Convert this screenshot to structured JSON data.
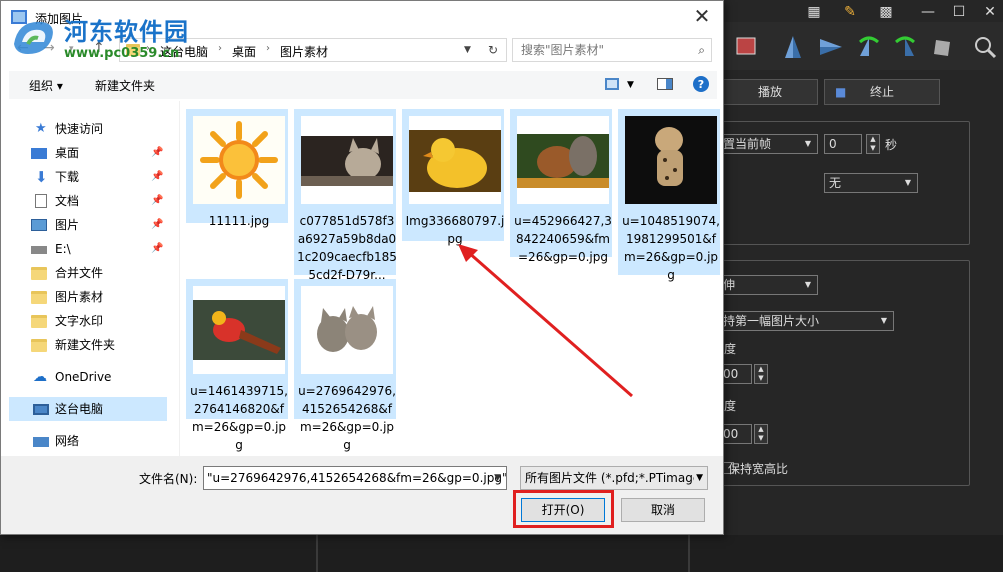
{
  "dialog": {
    "title": "添加图片",
    "close_glyph": "✕"
  },
  "watermark": {
    "text": "河东软件园",
    "url": "www.pc0359.cn"
  },
  "address": {
    "breadcrumbs": [
      "这台电脑",
      "桌面",
      "图片素材"
    ],
    "search_placeholder": "搜索\"图片素材\""
  },
  "commands": {
    "organize": "组织 ▾",
    "new_folder": "新建文件夹"
  },
  "nav": {
    "quick_access": "快速访问",
    "items": [
      {
        "label": "桌面",
        "icon": "desktop-icon",
        "pinned": true
      },
      {
        "label": "下载",
        "icon": "download-icon",
        "pinned": true
      },
      {
        "label": "文档",
        "icon": "document-icon",
        "pinned": true
      },
      {
        "label": "图片",
        "icon": "pictures-icon",
        "pinned": true
      },
      {
        "label": "E:\\",
        "icon": "drive-icon",
        "pinned": true
      },
      {
        "label": "合并文件",
        "icon": "folder-icon",
        "pinned": false
      },
      {
        "label": "图片素材",
        "icon": "folder-icon",
        "pinned": false
      },
      {
        "label": "文字水印",
        "icon": "folder-icon",
        "pinned": false
      },
      {
        "label": "新建文件夹",
        "icon": "folder-icon",
        "pinned": false
      }
    ],
    "onedrive": "OneDrive",
    "this_pc": "这台电脑",
    "network": "网络",
    "pin_glyph": "📌"
  },
  "files": [
    {
      "name": "11111.jpg",
      "thumb": "sun-drawing"
    },
    {
      "name": "c077851d578f3a6927a59b8da01c209caecfb1855cd2f-D79r...",
      "thumb": "kitten"
    },
    {
      "name": "Img336680797.jpg",
      "thumb": "duckling"
    },
    {
      "name": "u=452966427,3842240659&fm=26&gp=0.jpg",
      "thumb": "squirrel"
    },
    {
      "name": "u=1048519074,1981299501&fm=26&gp=0.jpg",
      "thumb": "cheetah-cub"
    },
    {
      "name": "u=1461439715,2764146820&fm=26&gp=0.jpg",
      "thumb": "pheasant"
    },
    {
      "name": "u=2769642976,4152654268&fm=26&gp=0.jpg",
      "thumb": "two-kittens"
    }
  ],
  "bottom": {
    "filename_label": "文件名(N):",
    "filename_value": "\"u=2769642976,4152654268&fm=26&gp=0.jpg\"",
    "filetype_value": "所有图片文件 (*.pfd;*.PTimage",
    "open_label": "打开(O)",
    "cancel_label": "取消"
  },
  "background_app": {
    "play_label": "播放",
    "stop_label": "终止",
    "set_current_frame": "置当前帧",
    "frame_value": "0",
    "seconds_unit": "秒",
    "none_option": "无",
    "stretch_option": "伸",
    "keep_first_size": "持第一幅图片大小",
    "degree_label_1": "度",
    "degree_label_2": "度",
    "spin_value_1": "00",
    "spin_value_2": "00",
    "keep_aspect": "保持宽高比"
  },
  "colors": {
    "selection": "#cce8ff",
    "accent": "#0078d7",
    "annotation_red": "#e02020",
    "dark_bg": "#262626"
  }
}
